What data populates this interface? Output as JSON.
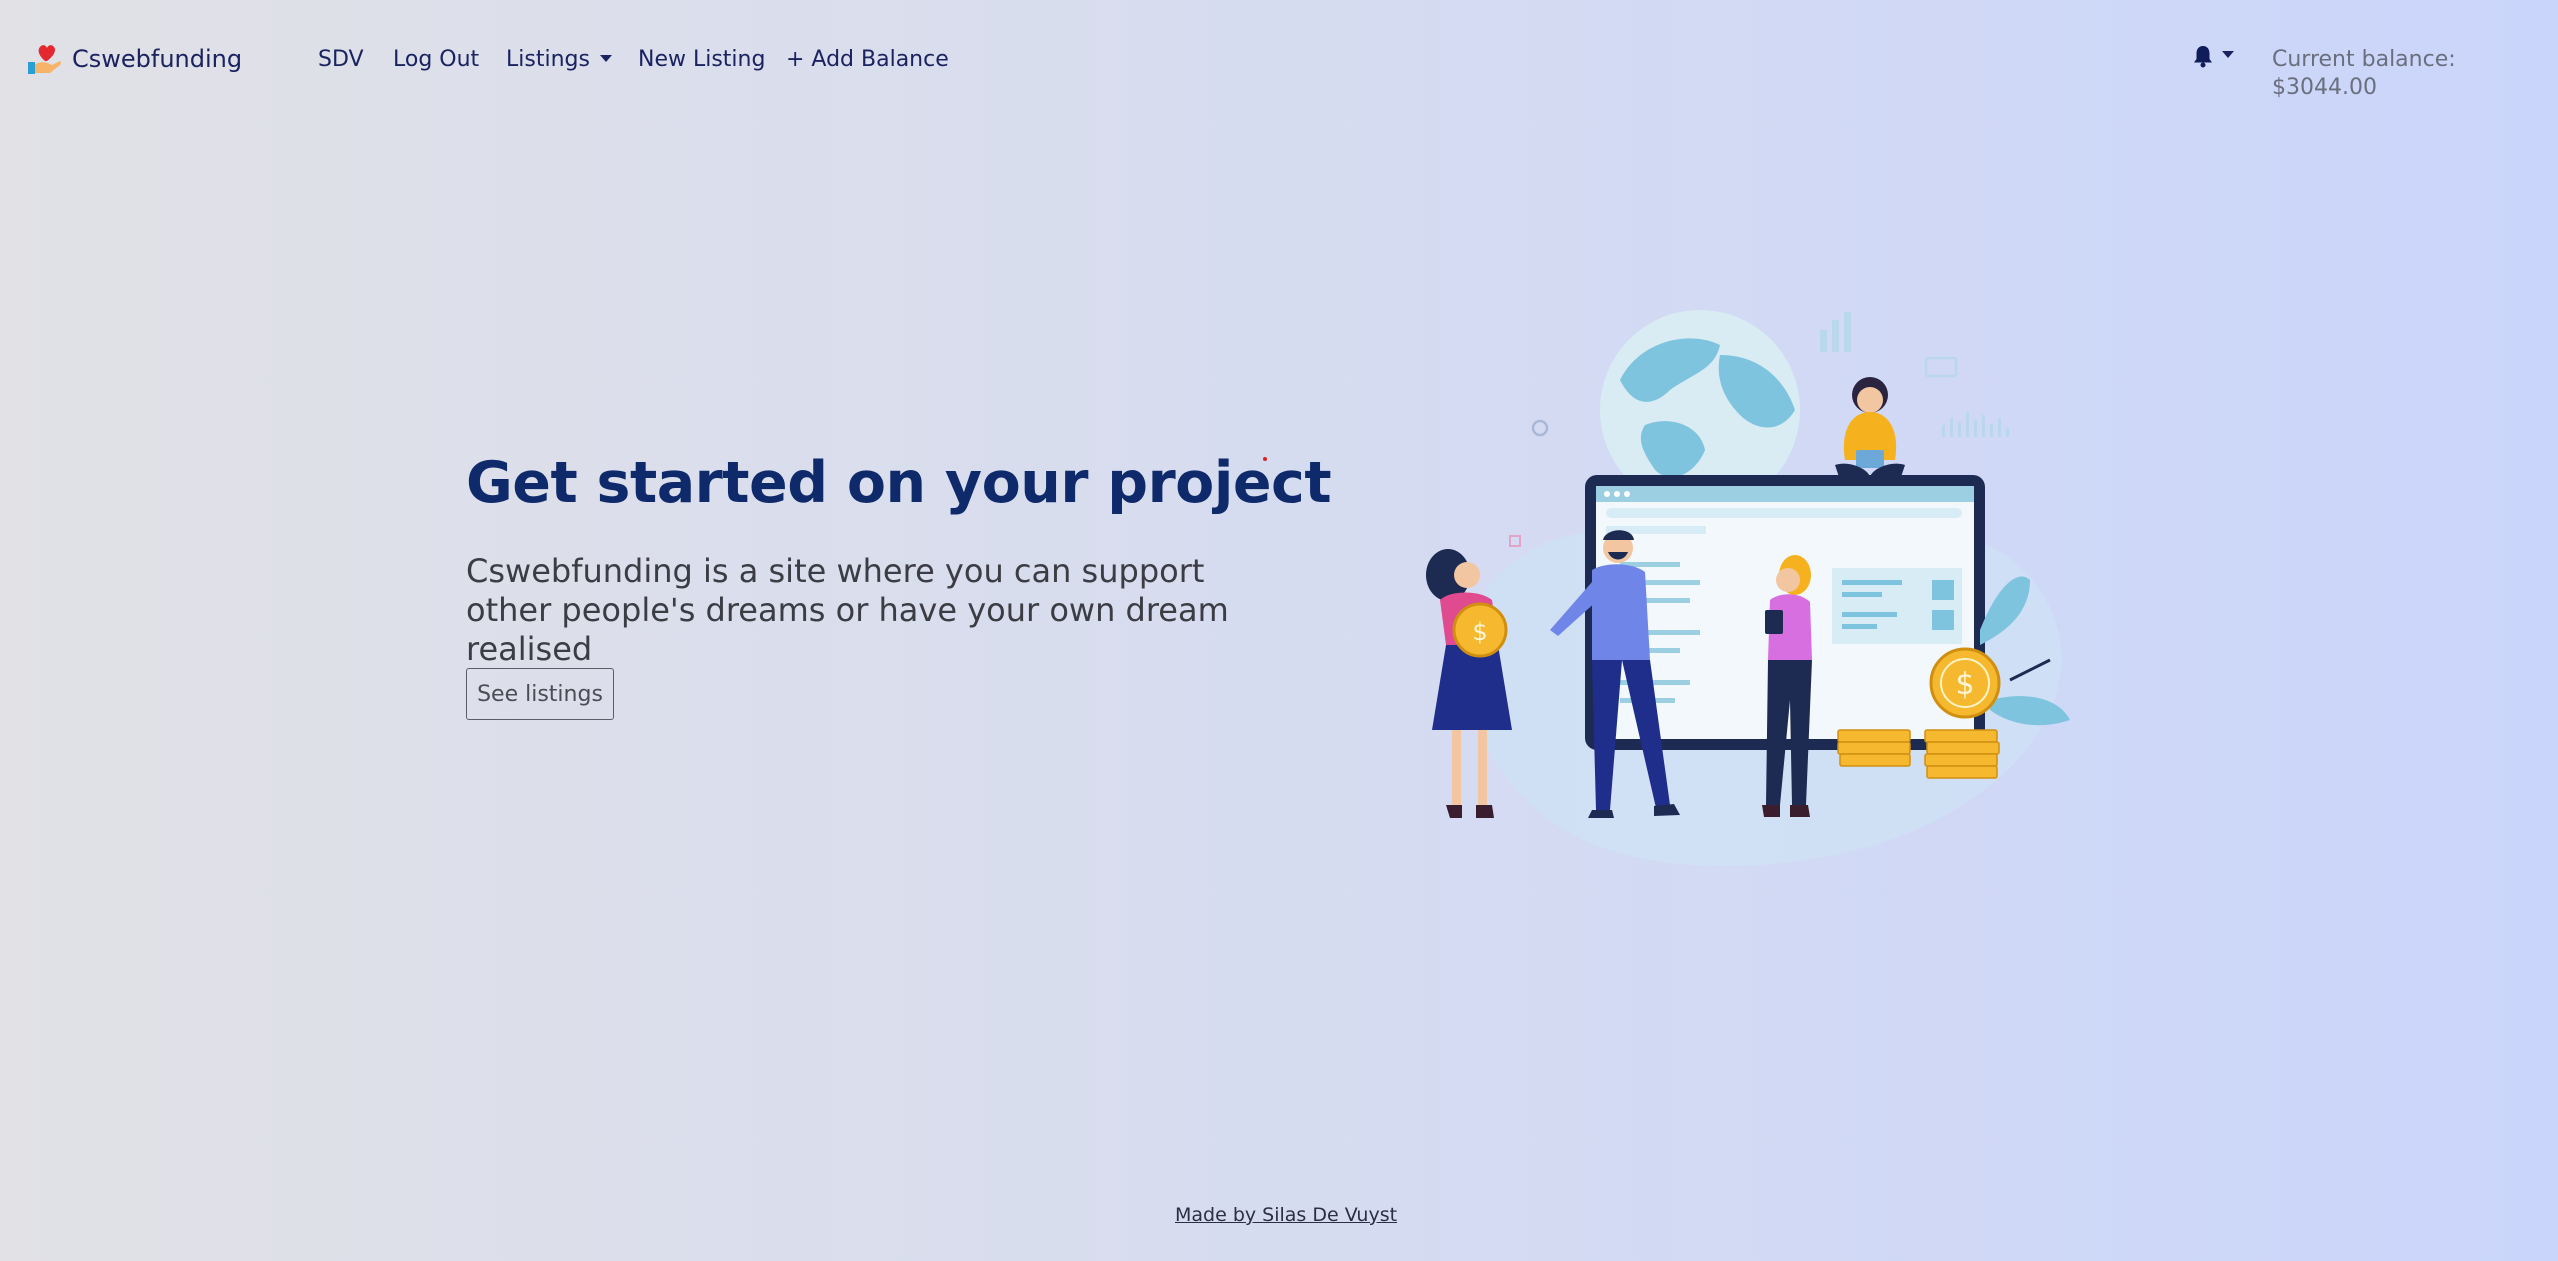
{
  "navbar": {
    "brand": "Cswebfunding",
    "links": {
      "sdv": "SDV",
      "logout": "Log Out",
      "listings": "Listings",
      "new_listing": "New Listing",
      "add_balance": "+ Add Balance"
    },
    "balance": "Current balance: $3044.00"
  },
  "hero": {
    "title": "Get started on your project",
    "subtitle": "Cswebfunding is a site where you can support other people's dreams or have your own dream realised",
    "button": "See listings"
  },
  "footer": {
    "credit": "Made by Silas De Vuyst"
  },
  "icons": {
    "brand": "heart-hand-logo-icon",
    "notifications": "bell-icon",
    "dropdown": "caret-down-icon"
  },
  "colors": {
    "title": "#0e2a6b",
    "nav_text": "#1a2360",
    "accent_coin": "#f5b82e",
    "illustration_blue": "#7fc4de"
  }
}
